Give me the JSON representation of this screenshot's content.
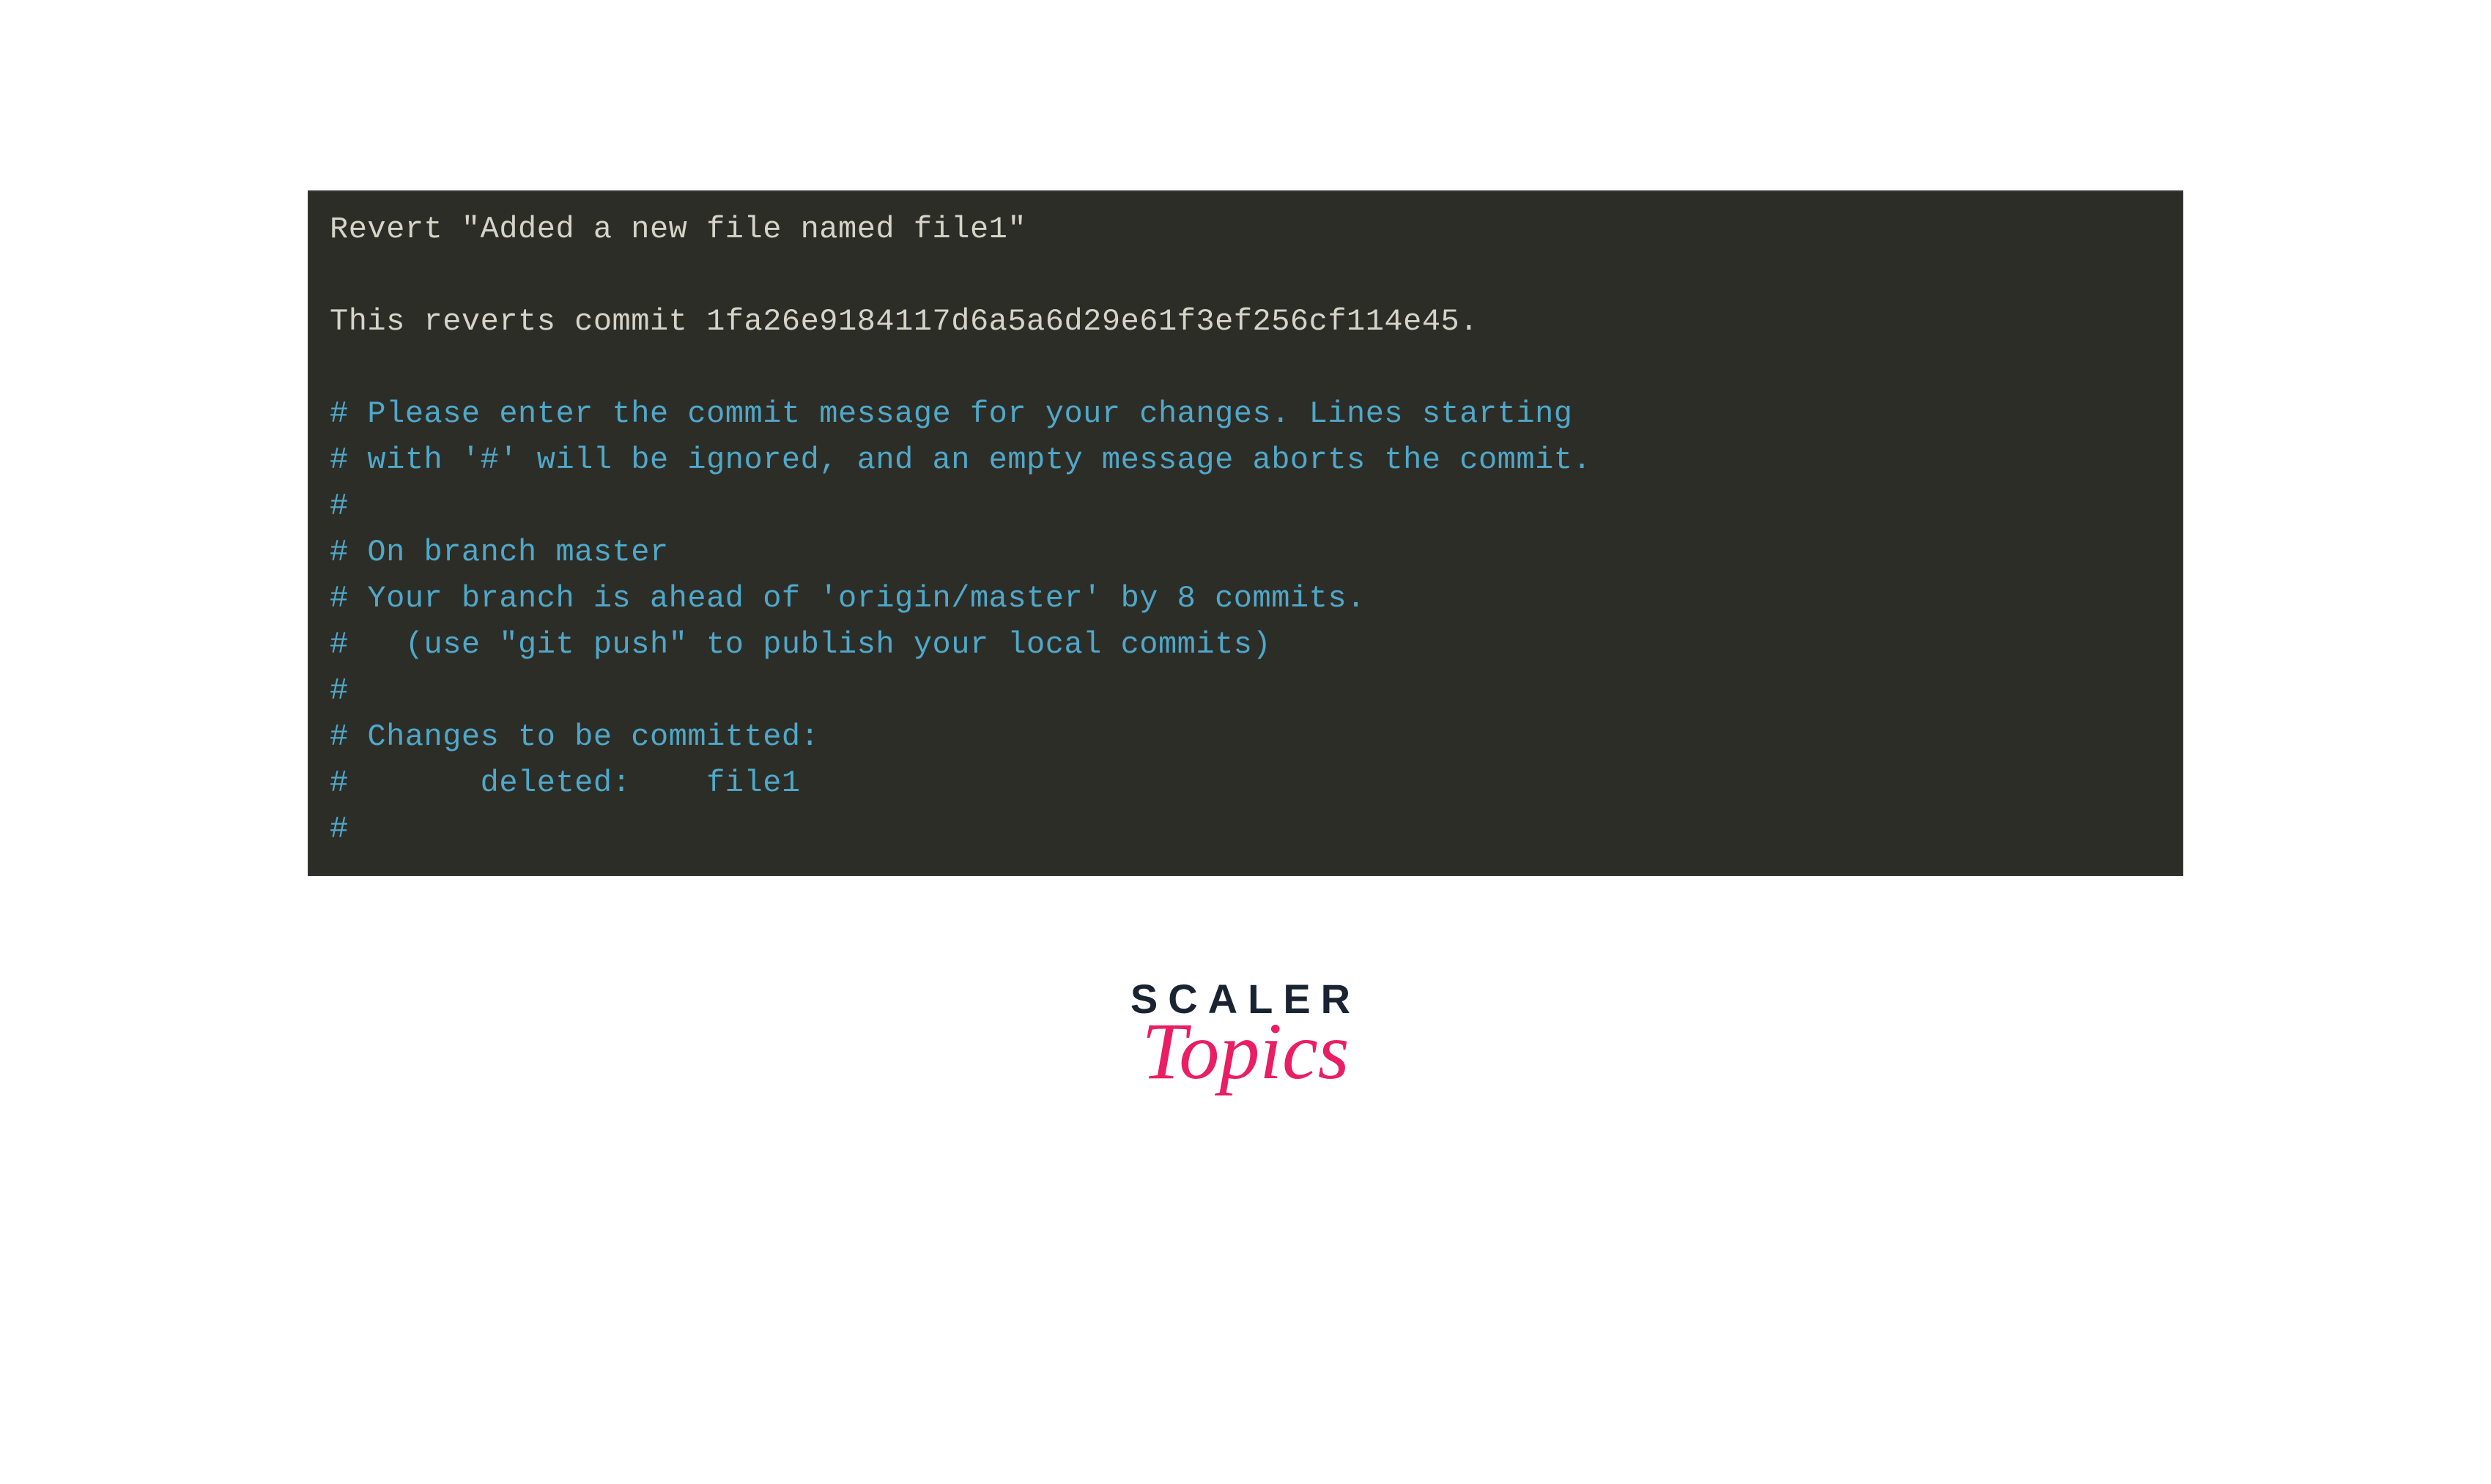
{
  "terminal": {
    "lines": [
      {
        "type": "plain",
        "text": "Revert \"Added a new file named file1\""
      },
      {
        "type": "blank",
        "text": ""
      },
      {
        "type": "plain",
        "text": "This reverts commit 1fa26e9184117d6a5a6d29e61f3ef256cf114e45."
      },
      {
        "type": "blank",
        "text": ""
      },
      {
        "type": "comment",
        "text": "# Please enter the commit message for your changes. Lines starting"
      },
      {
        "type": "comment",
        "text": "# with '#' will be ignored, and an empty message aborts the commit."
      },
      {
        "type": "comment",
        "text": "#"
      },
      {
        "type": "comment",
        "text": "# On branch master"
      },
      {
        "type": "comment",
        "text": "# Your branch is ahead of 'origin/master' by 8 commits."
      },
      {
        "type": "comment",
        "text": "#   (use \"git push\" to publish your local commits)"
      },
      {
        "type": "comment",
        "text": "#"
      },
      {
        "type": "comment",
        "text": "# Changes to be committed:"
      },
      {
        "type": "comment",
        "text": "#       deleted:    file1"
      },
      {
        "type": "comment",
        "text": "#"
      }
    ]
  },
  "branding": {
    "line1": "SCALER",
    "line2": "Topics"
  }
}
